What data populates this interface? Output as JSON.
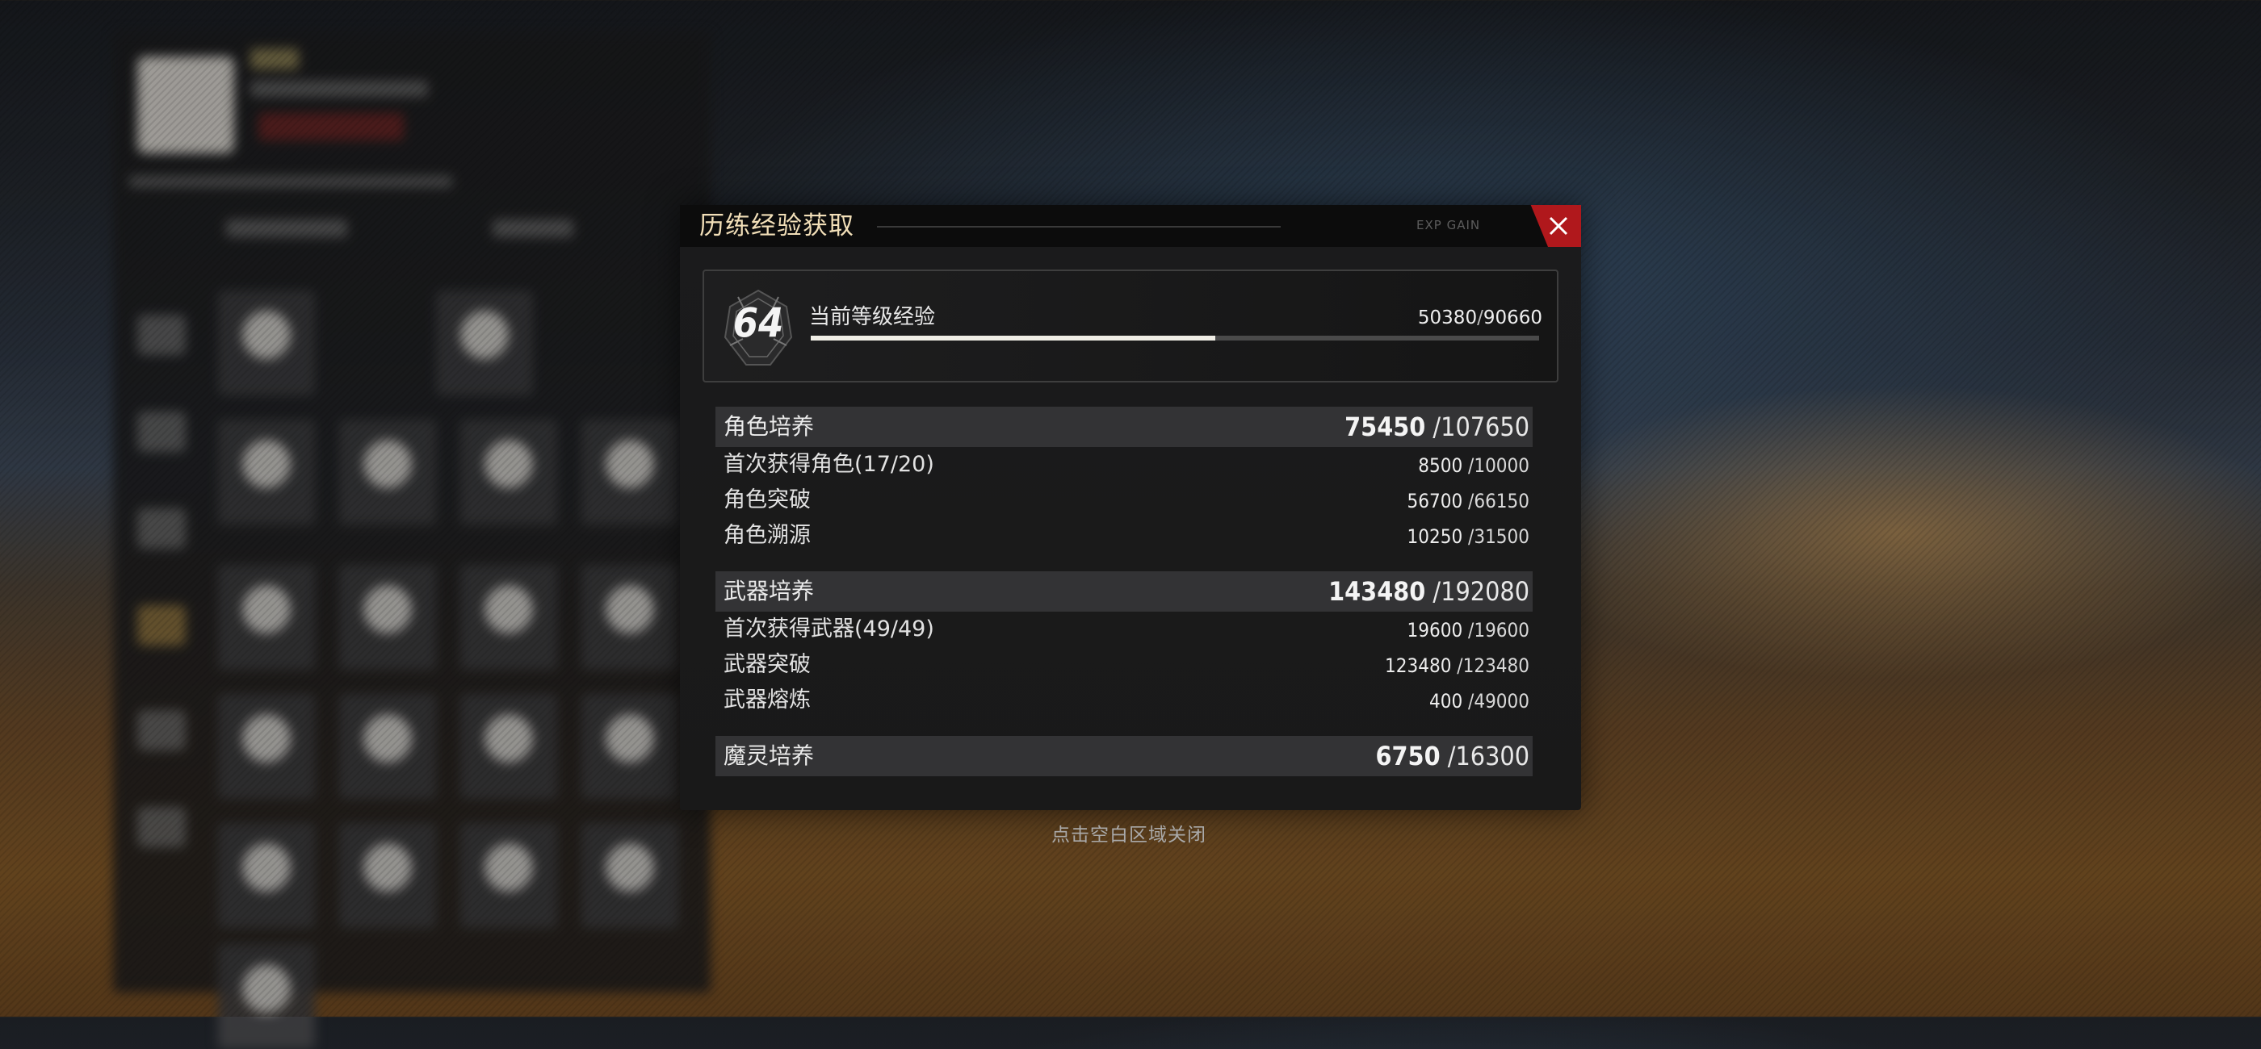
{
  "dialog": {
    "title": "历练经验获取",
    "deco_text": "EXP GAIN",
    "close_icon": "close-icon"
  },
  "level": {
    "number": "64",
    "label": "当前等级经验",
    "current": "50380",
    "max": "90660",
    "progress": 0.5557
  },
  "sections": [
    {
      "title": "角色培养",
      "current": "75450",
      "total": "107650",
      "rows": [
        {
          "label": "首次获得角色(17/20)",
          "current": "8500",
          "total": "10000"
        },
        {
          "label": "角色突破",
          "current": "56700",
          "total": "66150"
        },
        {
          "label": "角色溯源",
          "current": "10250",
          "total": "31500"
        }
      ]
    },
    {
      "title": "武器培养",
      "current": "143480",
      "total": "192080",
      "rows": [
        {
          "label": "首次获得武器(49/49)",
          "current": "19600",
          "total": "19600"
        },
        {
          "label": "武器突破",
          "current": "123480",
          "total": "123480"
        },
        {
          "label": "武器熔炼",
          "current": "400",
          "total": "49000"
        }
      ]
    },
    {
      "title": "魔灵培养",
      "current": "6750",
      "total": "16300",
      "rows": []
    }
  ],
  "close_hint": "点击空白区域关闭",
  "colors": {
    "accent_red": "#b0181c",
    "title_gold": "#f2dfb8"
  }
}
